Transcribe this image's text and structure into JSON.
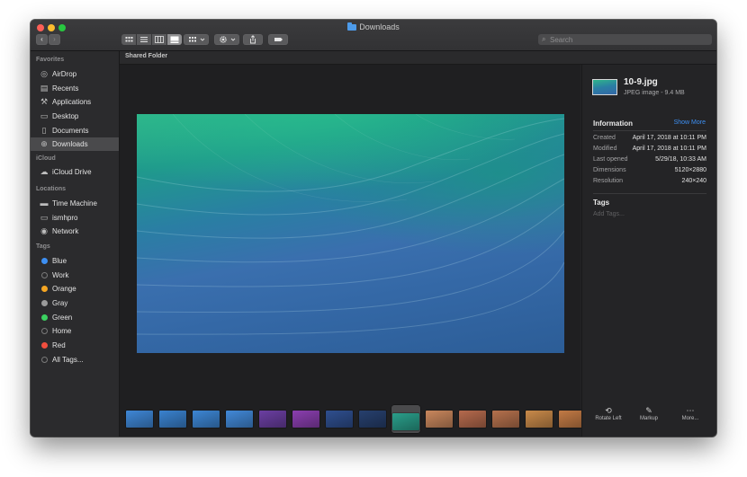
{
  "window": {
    "title": "Downloads"
  },
  "toolbar": {
    "back": "‹",
    "forward": "›",
    "search_placeholder": "Search"
  },
  "sidebar": {
    "sections": [
      {
        "label": "Favorites",
        "items": [
          {
            "label": "AirDrop",
            "icon": "airdrop-icon",
            "glyph": "◎"
          },
          {
            "label": "Recents",
            "icon": "recents-icon",
            "glyph": "▤"
          },
          {
            "label": "Applications",
            "icon": "applications-icon",
            "glyph": "⚒"
          },
          {
            "label": "Desktop",
            "icon": "desktop-icon",
            "glyph": "▭"
          },
          {
            "label": "Documents",
            "icon": "documents-icon",
            "glyph": "▯"
          },
          {
            "label": "Downloads",
            "icon": "downloads-icon",
            "glyph": "⊕",
            "selected": true
          }
        ]
      },
      {
        "label": "iCloud",
        "items": [
          {
            "label": "iCloud Drive",
            "icon": "icloud-icon",
            "glyph": "☁"
          }
        ]
      },
      {
        "label": "Locations",
        "items": [
          {
            "label": "Time Machine",
            "icon": "time-machine-icon",
            "glyph": "▬"
          },
          {
            "label": "ismhpro",
            "icon": "computer-icon",
            "glyph": "▭"
          },
          {
            "label": "Network",
            "icon": "network-icon",
            "glyph": "◉"
          }
        ]
      },
      {
        "label": "Tags",
        "items": [
          {
            "label": "Blue",
            "color": "#3d8ff2"
          },
          {
            "label": "Work",
            "color": "",
            "hollow": true
          },
          {
            "label": "Orange",
            "color": "#f5a623"
          },
          {
            "label": "Gray",
            "color": "#9b9b9b"
          },
          {
            "label": "Green",
            "color": "#3bd160"
          },
          {
            "label": "Home",
            "color": "",
            "hollow": true
          },
          {
            "label": "Red",
            "color": "#f04e3e"
          },
          {
            "label": "All Tags...",
            "color": "",
            "hollow": true
          }
        ]
      }
    ]
  },
  "path": {
    "label": "Shared Folder"
  },
  "inspector": {
    "file_name": "10-9.jpg",
    "file_kind": "JPEG image - 9.4 MB",
    "information_label": "Information",
    "show_more": "Show More",
    "rows": [
      {
        "key": "Created",
        "value": "April 17, 2018 at 10:11 PM"
      },
      {
        "key": "Modified",
        "value": "April 17, 2018 at 10:11 PM"
      },
      {
        "key": "Last opened",
        "value": "5/29/18, 10:33 AM"
      },
      {
        "key": "Dimensions",
        "value": "5120×2880"
      },
      {
        "key": "Resolution",
        "value": "240×240"
      }
    ],
    "tags_label": "Tags",
    "add_tags": "Add Tags...",
    "actions": [
      {
        "label": "Rotate Left",
        "icon": "rotate-left-icon",
        "glyph": "⟲"
      },
      {
        "label": "Markup",
        "icon": "markup-icon",
        "glyph": "✎"
      },
      {
        "label": "More...",
        "icon": "more-icon",
        "glyph": "⋯"
      }
    ]
  },
  "filmstrip": {
    "selected_index": 8,
    "thumbs": [
      "#3f87d6",
      "#3a82cf",
      "#3d86d4",
      "#4289d8",
      "#6b3fa2",
      "#8b3fb0",
      "#2f4f8f",
      "#27406e",
      "#2a9e8a",
      "#c9875d",
      "#b56a4d",
      "#b5714d",
      "#c98a4a",
      "#c27a45"
    ]
  }
}
